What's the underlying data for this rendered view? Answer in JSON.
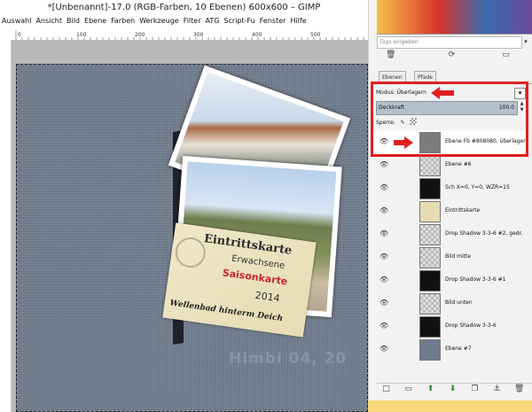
{
  "window": {
    "title": "*[Unbenannt]-17.0 (RGB-Farben, 10 Ebenen) 600x600 – GIMP"
  },
  "menu": [
    "Auswahl",
    "Ansicht",
    "Bild",
    "Ebene",
    "Farben",
    "Werkzeuge",
    "Filter",
    "ATG",
    "Script-Fu",
    "Fenster",
    "Hilfe"
  ],
  "ruler": {
    "ticks": [
      "0",
      "100",
      "200",
      "300",
      "400",
      "500"
    ]
  },
  "canvas": {
    "watermark": "Himbi 04, 20"
  },
  "ticket": {
    "line1": "Eintrittskarte",
    "line2": "Erwachsene",
    "line3": "Saisonkarte",
    "line4": "2014",
    "line5": "Wellenbad hinterm Deich"
  },
  "panel": {
    "tags_placeholder": "Tags eingeben",
    "tabs": [
      "Ebenen",
      "Pfade"
    ],
    "mode_label": "Modus: Überlagern",
    "opacity_label": "Deckkraft",
    "opacity_value": "100.0",
    "lock_label": "Sperre:",
    "layers": [
      {
        "name": "Ebene Fb #808080, überlagert",
        "thumb": "#7c7c7c"
      },
      {
        "name": "Ebene #6",
        "thumb": "checker"
      },
      {
        "name": "Sch X=0, Y=0, WZR=15",
        "thumb": "#111111"
      },
      {
        "name": "Eintrittskarte",
        "thumb": "#e6dcb4"
      },
      {
        "name": "Drop Shadow 3-3-6 #2, gedr.",
        "thumb": "checker"
      },
      {
        "name": "Bild mitte",
        "thumb": "checker"
      },
      {
        "name": "Drop Shadow 3-3-6 #1",
        "thumb": "#111111"
      },
      {
        "name": "Bild unten",
        "thumb": "checker"
      },
      {
        "name": "Drop Shadow 3-3-6",
        "thumb": "#111111"
      },
      {
        "name": "Ebene #7",
        "thumb": "#6f7a8a"
      }
    ]
  },
  "colors": {
    "highlight_red": "#e02020",
    "canvas": "#6f7a8a"
  }
}
